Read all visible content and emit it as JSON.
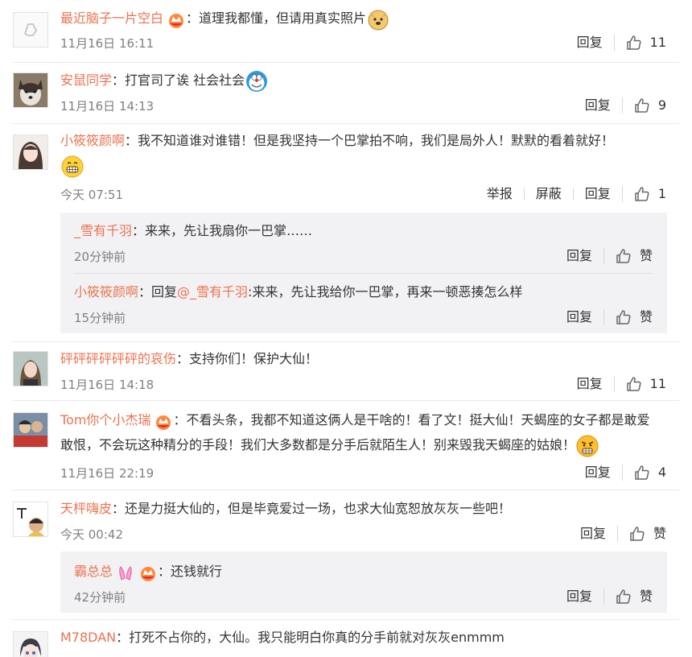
{
  "comments": [
    {
      "user": "最近脑子一片空白",
      "text": "：道理我都懂，但请用真实照片",
      "time": "11月16日 16:11",
      "reply": "回复",
      "likes": "11"
    },
    {
      "user": "安鼠同学",
      "text": "：打官司了诶 社会社会",
      "time": "11月16日 14:13",
      "reply": "回复",
      "likes": "9"
    },
    {
      "user": "小筱筱颜啊",
      "text": "：我不知道谁对谁错！但是我坚持一个巴掌拍不响，我们是局外人！默默的看着就好！",
      "time": "今天 07:51",
      "report": "举报",
      "block": "屏蔽",
      "reply": "回复",
      "likes": "1",
      "replies": [
        {
          "user": "_雪有千羽",
          "text": "：来来，先让我扇你一巴掌……",
          "time": "20分钟前",
          "reply": "回复",
          "like": "赞"
        },
        {
          "user": "小筱筱颜啊",
          "prefix": "：回复",
          "mention": "@_雪有千羽",
          "text": ":来来，先让我给你一巴掌，再来一顿恶揍怎么样",
          "time": "15分钟前",
          "reply": "回复",
          "like": "赞"
        }
      ]
    },
    {
      "user": "砰砰砰砰砰砰的哀伤",
      "text": "：支持你们！保护大仙！",
      "time": "11月16日 14:18",
      "reply": "回复",
      "likes": "11"
    },
    {
      "user": "Tom你个小杰瑞",
      "text": "：不看头条，我都不知道这俩人是干啥的！看了文！挺大仙！天蝎座的女子都是敢爱敢恨，不会玩这种精分的手段！我们大多数都是分手后就陌生人！别来毁我天蝎座的姑娘！",
      "time": "11月16日 22:19",
      "reply": "回复",
      "likes": "4"
    },
    {
      "user": "天枰嗨皮",
      "text": "：还是力挺大仙的，但是毕竟爱过一场，也求大仙宽恕放灰灰一些吧！",
      "time": "今天 00:42",
      "reply": "回复",
      "like": "赞",
      "replies": [
        {
          "user": "霸总总",
          "text": "：还钱就行",
          "time": "42分钟前",
          "reply": "回复",
          "like": "赞"
        }
      ]
    },
    {
      "user": "M78DAN",
      "text": "：打死不占你的，大仙。我只能明白你真的分手前就对灰灰enmmm"
    }
  ],
  "colors": {
    "username": "#eb7350",
    "time": "#808080",
    "reply_bg": "#f2f2f5"
  },
  "icons": [
    "thumbs-up-icon",
    "emoji-doge",
    "emoji-doraemon",
    "emoji-grin",
    "emoji-angry",
    "vip-crown-badge",
    "bunny-ears-icon"
  ]
}
